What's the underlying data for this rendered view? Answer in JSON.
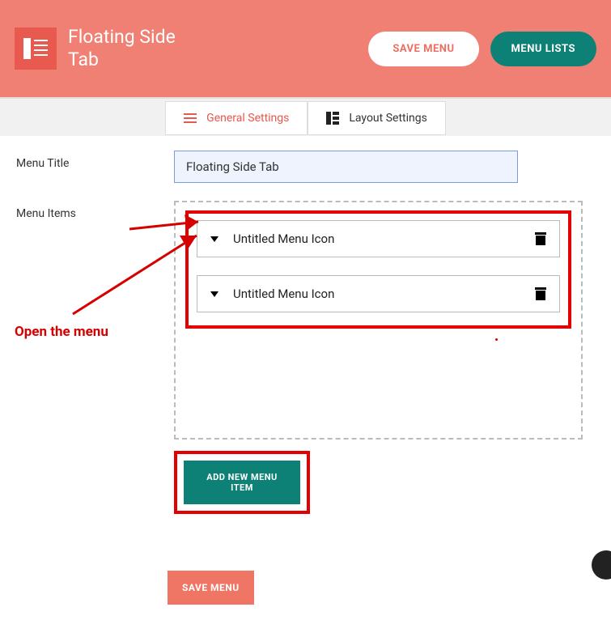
{
  "header": {
    "title": "Floating Side Tab",
    "save_menu_label": "SAVE MENU",
    "menu_lists_label": "MENU LISTS"
  },
  "tabs": {
    "general_label": "General Settings",
    "layout_label": "Layout Settings"
  },
  "form": {
    "menu_title_label": "Menu Title",
    "menu_title_value": "Floating Side Tab",
    "menu_items_label": "Menu Items",
    "items": [
      {
        "label": "Untitled Menu Icon"
      },
      {
        "label": "Untitled Menu Icon"
      }
    ],
    "add_item_label": "ADD NEW MENU ITEM",
    "save_menu_label": "SAVE MENU"
  },
  "annotation": {
    "text": "Open the menu"
  }
}
